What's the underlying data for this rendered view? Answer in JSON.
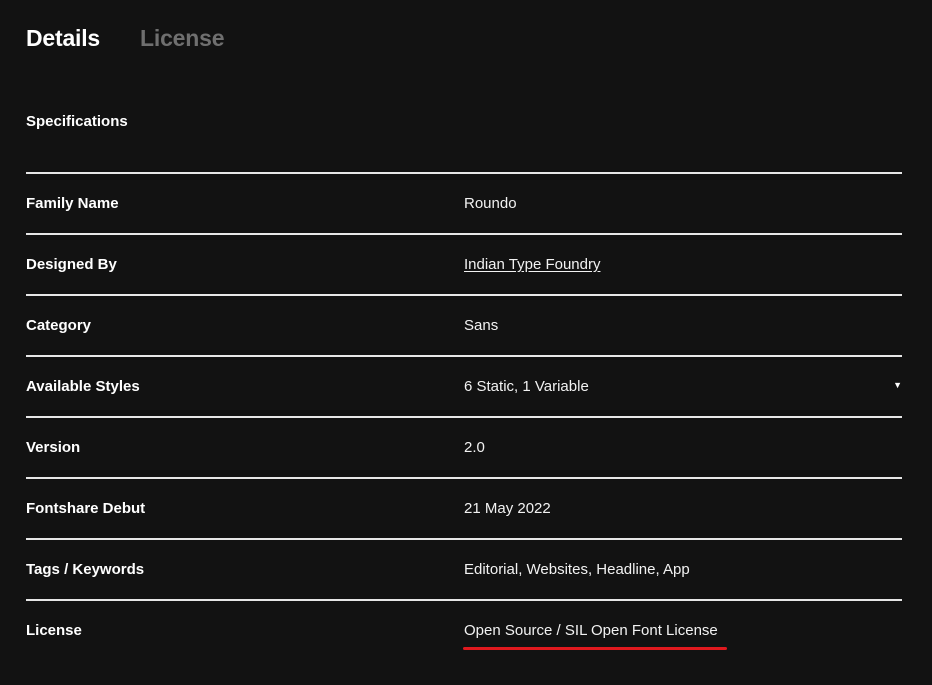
{
  "tabs": [
    {
      "label": "Details",
      "active": true
    },
    {
      "label": "License",
      "active": false
    }
  ],
  "section_title": "Specifications",
  "specs": {
    "family_name": {
      "label": "Family Name",
      "value": "Roundo"
    },
    "designed_by": {
      "label": "Designed By",
      "value": "Indian Type Foundry"
    },
    "category": {
      "label": "Category",
      "value": "Sans"
    },
    "available_styles": {
      "label": "Available Styles",
      "value": "6 Static, 1 Variable",
      "caret_icon": "triangle-down-icon"
    },
    "version": {
      "label": "Version",
      "value": "2.0"
    },
    "fontshare_debut": {
      "label": "Fontshare Debut",
      "value": "21 May 2022"
    },
    "tags": {
      "label": "Tags / Keywords",
      "value": "Editorial, Websites, Headline, App"
    },
    "license": {
      "label": "License",
      "value": "Open Source / SIL Open Font License"
    }
  },
  "colors": {
    "background": "#121212",
    "text": "#ffffff",
    "inactive_tab": "#6f6f6f",
    "divider": "#e6e6e6",
    "license_underline": "#e0191e"
  }
}
